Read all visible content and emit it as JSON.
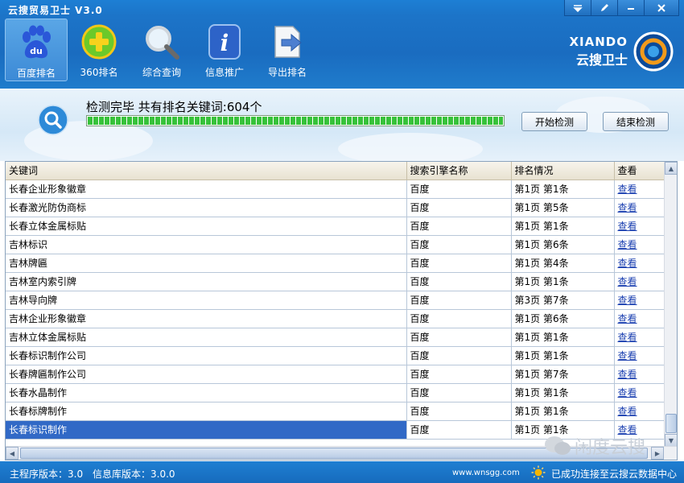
{
  "app": {
    "title": "云搜贸易卫士 V3.0"
  },
  "window_controls": {
    "menu_icon": "menu-icon",
    "pen_icon": "edit-icon",
    "min_icon": "minimize-icon",
    "close_icon": "close-icon"
  },
  "toolbar": {
    "items": [
      {
        "label": "百度排名",
        "icon": "baidu-paw-icon",
        "active": true
      },
      {
        "label": "360排名",
        "icon": "plus-360-icon",
        "active": false
      },
      {
        "label": "综合查询",
        "icon": "magnifier-icon",
        "active": false
      },
      {
        "label": "信息推广",
        "icon": "info-icon",
        "active": false
      },
      {
        "label": "导出排名",
        "icon": "export-arrow-icon",
        "active": false
      }
    ]
  },
  "logo": {
    "line1": "XIANDO",
    "line2": "云搜卫士"
  },
  "status": {
    "message": "检测完毕 共有排名关键词:604个",
    "progress": 1.0,
    "start_button": "开始检测",
    "stop_button": "结束检测"
  },
  "table": {
    "headers": [
      "关键词",
      "搜索引擎名称",
      "排名情况",
      "查看"
    ],
    "rows": [
      {
        "keyword": "长春企业形象徽章",
        "engine": "百度",
        "rank": "第1页 第1条",
        "view": "查看"
      },
      {
        "keyword": "长春激光防伪商标",
        "engine": "百度",
        "rank": "第1页 第5条",
        "view": "查看"
      },
      {
        "keyword": "长春立体金属标贴",
        "engine": "百度",
        "rank": "第1页 第1条",
        "view": "查看"
      },
      {
        "keyword": "吉林标识",
        "engine": "百度",
        "rank": "第1页 第6条",
        "view": "查看"
      },
      {
        "keyword": "吉林牌匾",
        "engine": "百度",
        "rank": "第1页 第4条",
        "view": "查看"
      },
      {
        "keyword": "吉林室内索引牌",
        "engine": "百度",
        "rank": "第1页 第1条",
        "view": "查看"
      },
      {
        "keyword": "吉林导向牌",
        "engine": "百度",
        "rank": "第3页 第7条",
        "view": "查看"
      },
      {
        "keyword": "吉林企业形象徽章",
        "engine": "百度",
        "rank": "第1页 第6条",
        "view": "查看"
      },
      {
        "keyword": "吉林立体金属标贴",
        "engine": "百度",
        "rank": "第1页 第1条",
        "view": "查看"
      },
      {
        "keyword": "长春标识制作公司",
        "engine": "百度",
        "rank": "第1页 第1条",
        "view": "查看"
      },
      {
        "keyword": "长春牌匾制作公司",
        "engine": "百度",
        "rank": "第1页 第7条",
        "view": "查看"
      },
      {
        "keyword": "长春水晶制作",
        "engine": "百度",
        "rank": "第1页 第1条",
        "view": "查看"
      },
      {
        "keyword": "长春标牌制作",
        "engine": "百度",
        "rank": "第1页 第1条",
        "view": "查看"
      },
      {
        "keyword": "长春标识制作",
        "engine": "百度",
        "rank": "第1页 第1条",
        "view": "查看",
        "selected": true
      }
    ]
  },
  "watermark": {
    "text": "闲度云搜"
  },
  "footer": {
    "main_version": "主程序版本：3.0",
    "db_version": "信息库版本：3.0.0",
    "url": "www.wnsgg.com",
    "connection": "已成功连接至云搜云数据中心"
  }
}
